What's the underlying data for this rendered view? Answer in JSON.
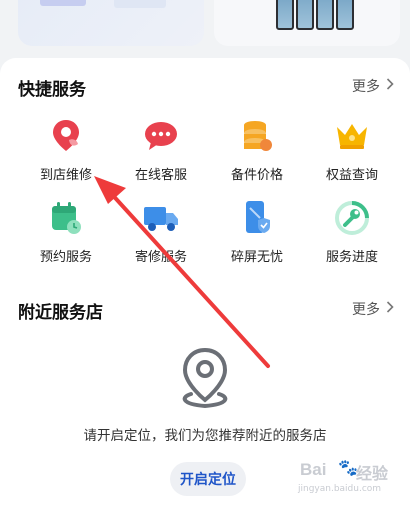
{
  "quick_services": {
    "title": "快捷服务",
    "more_label": "更多",
    "items": [
      {
        "label": "到店维修",
        "icon": "location-pin-icon",
        "color": "#e8414e"
      },
      {
        "label": "在线客服",
        "icon": "chat-bubble-icon",
        "color": "#e8414e"
      },
      {
        "label": "备件价格",
        "icon": "coin-stack-icon",
        "color": "#f5a623"
      },
      {
        "label": "权益查询",
        "icon": "crown-icon",
        "color": "#f7b500"
      },
      {
        "label": "预约服务",
        "icon": "calendar-clock-icon",
        "color": "#3dbf8a"
      },
      {
        "label": "寄修服务",
        "icon": "delivery-truck-icon",
        "color": "#3d8ee8"
      },
      {
        "label": "碎屏无忧",
        "icon": "phone-shield-icon",
        "color": "#3d8ee8"
      },
      {
        "label": "服务进度",
        "icon": "wrench-progress-icon",
        "color": "#3dbf8a"
      }
    ]
  },
  "nearby_stores": {
    "title": "附近服务店",
    "more_label": "更多",
    "empty_message": "请开启定位，我们为您推荐附近的服务店",
    "enable_location_button": "开启定位"
  },
  "watermark": {
    "brand": "Bai",
    "brand_suffix": "经验",
    "url": "jingyan.baidu.com"
  },
  "colors": {
    "accent_blue": "#1f55c8",
    "annotation_arrow": "#ee3b3b"
  }
}
